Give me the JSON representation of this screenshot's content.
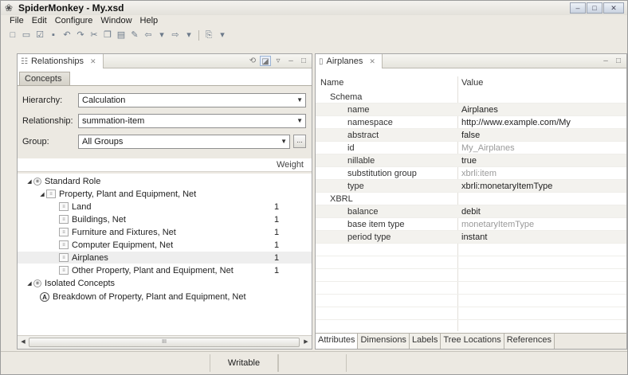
{
  "window": {
    "title": "SpiderMonkey - My.xsd",
    "controls": [
      "–",
      "□",
      "✕"
    ]
  },
  "menu": [
    "File",
    "Edit",
    "Configure",
    "Window",
    "Help"
  ],
  "left_pane": {
    "tab_label": "Relationships",
    "sub_tab": "Concepts",
    "hierarchy": {
      "label": "Hierarchy:",
      "value": "Calculation"
    },
    "relationship": {
      "label": "Relationship:",
      "value": "summation-item"
    },
    "group": {
      "label": "Group:",
      "value": "All Groups",
      "button": "..."
    },
    "weight_header": "Weight",
    "tree": [
      {
        "label": "Standard Role",
        "weight": ""
      },
      {
        "label": "Property, Plant and Equipment, Net",
        "weight": ""
      },
      {
        "label": "Land",
        "weight": "1"
      },
      {
        "label": "Buildings, Net",
        "weight": "1"
      },
      {
        "label": "Furniture and Fixtures, Net",
        "weight": "1"
      },
      {
        "label": "Computer Equipment, Net",
        "weight": "1"
      },
      {
        "label": "Airplanes",
        "weight": "1"
      },
      {
        "label": "Other Property, Plant and Equipment, Net",
        "weight": "1"
      },
      {
        "label": "Isolated Concepts",
        "weight": ""
      },
      {
        "label": "Breakdown of Property, Plant and Equipment, Net",
        "weight": "",
        "icon_letter": "A"
      }
    ],
    "scroll_thumb": "III"
  },
  "right_pane": {
    "tab_label": "Airplanes",
    "columns": {
      "name": "Name",
      "value": "Value"
    },
    "rows": [
      {
        "name": "Schema",
        "value": ""
      },
      {
        "name": "name",
        "value": "Airplanes"
      },
      {
        "name": "namespace",
        "value": "http://www.example.com/My"
      },
      {
        "name": "abstract",
        "value": "false"
      },
      {
        "name": "id",
        "value": "My_Airplanes"
      },
      {
        "name": "nillable",
        "value": "true"
      },
      {
        "name": "substitution group",
        "value": "xbrli:item"
      },
      {
        "name": "type",
        "value": "xbrli:monetaryItemType"
      },
      {
        "name": "XBRL",
        "value": ""
      },
      {
        "name": "balance",
        "value": "debit"
      },
      {
        "name": "base item type",
        "value": "monetaryItemType"
      },
      {
        "name": "period type",
        "value": "instant"
      }
    ],
    "bottom_tabs": [
      "Attributes",
      "Dimensions",
      "Labels",
      "Tree Locations",
      "References"
    ]
  },
  "status": {
    "mode": "Writable"
  }
}
